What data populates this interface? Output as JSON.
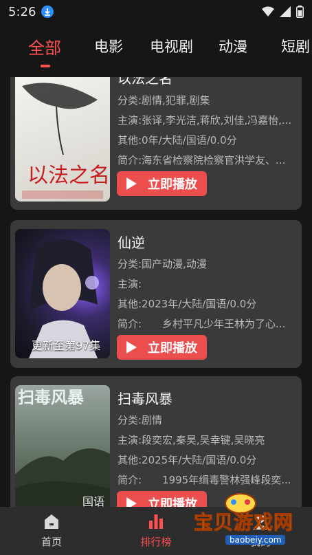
{
  "status": {
    "time": "5:26"
  },
  "tabs": [
    {
      "label": "全部"
    },
    {
      "label": "电影"
    },
    {
      "label": "电视剧"
    },
    {
      "label": "动漫"
    },
    {
      "label": "短剧"
    }
  ],
  "cards": [
    {
      "title": "以法之名",
      "category": "分类:剧情,犯罪,剧集",
      "cast": "主演:张译,李光洁,蒋欣,刘佳,冯嘉怡,...",
      "other": "其他:0年/大陆/国语/0.0分",
      "intro": "简介:海东省检察院检察官洪学友、...",
      "play_label": "立即播放",
      "poster_caption": ""
    },
    {
      "title": "仙逆",
      "category": "分类:国产动漫,动漫",
      "cast": "主演:",
      "other": "其他:2023年/大陆/国语/0.0分",
      "intro": "简介:　　乡村平凡少年王林为了心...",
      "play_label": "立即播放",
      "poster_caption": "更新至第97集"
    },
    {
      "title": "扫毒风暴",
      "category": "分类:剧情",
      "cast": "主演:段奕宏,秦昊,吴幸键,吴晓亮",
      "other": "其他:2025年/大陆/国语/0.0分",
      "intro": "简介:　　1995年缉毒警林强峰段奕...",
      "play_label": "立即播放",
      "poster_caption": "国语"
    }
  ],
  "bottom_nav": [
    {
      "label": "首页",
      "icon": "home-icon"
    },
    {
      "label": "排行榜",
      "icon": "chart-icon"
    },
    {
      "label": "我的",
      "icon": "profile-icon"
    }
  ],
  "watermark": {
    "name": "宝贝游戏网",
    "url": "baobeiy.com"
  },
  "colors": {
    "accent": "#ff4f4f",
    "button": "#ec4d4d",
    "card": "#3a3a3a",
    "background": "#161616"
  }
}
